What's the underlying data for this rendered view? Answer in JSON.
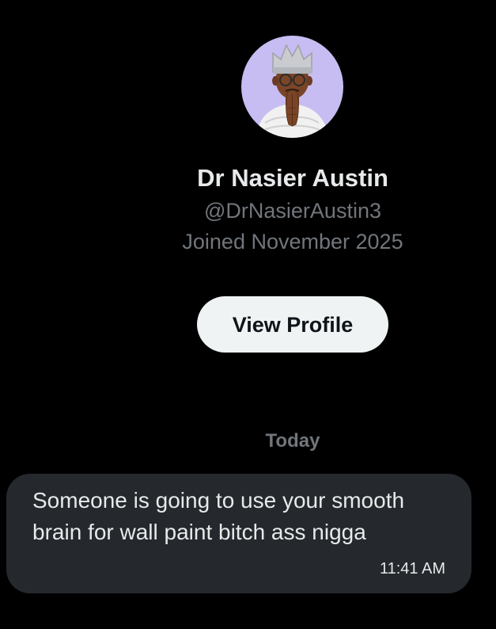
{
  "profile": {
    "display_name": "Dr Nasier Austin",
    "handle": "@DrNasierAustin3",
    "joined": "Joined November 2025",
    "avatar_icon": "crowned-memoji-praying-hands",
    "view_profile_label": "View Profile"
  },
  "conversation": {
    "date_separator": "Today",
    "messages": [
      {
        "text": "Someone is going to use your smooth brain for wall paint bitch ass nigga",
        "time": "11:41 AM"
      }
    ]
  },
  "colors": {
    "background": "#000000",
    "primary_text": "#e7e9ea",
    "secondary_text": "#71767b",
    "button_bg": "#eff3f4",
    "button_text": "#0f1419",
    "bubble_bg": "#25282c",
    "avatar_bg": "#c7bdf2"
  }
}
